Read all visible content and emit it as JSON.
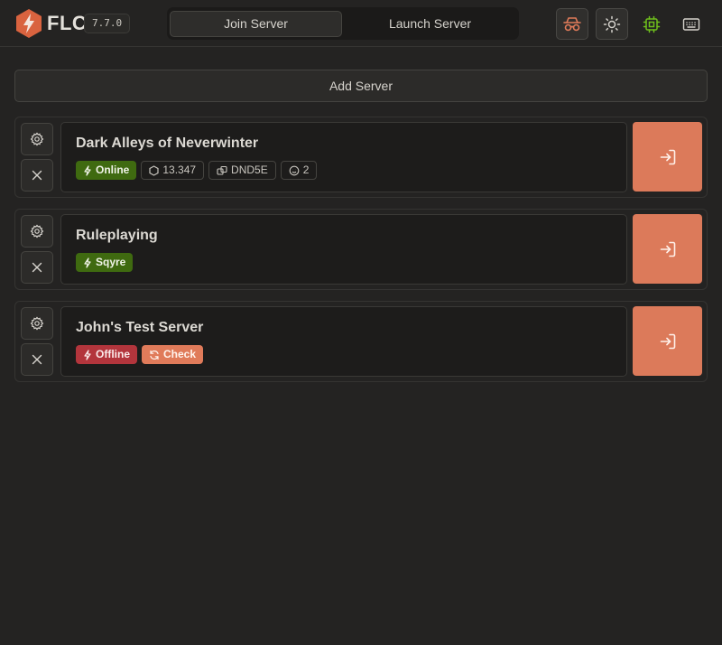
{
  "app": {
    "brand": "FLC",
    "version": "7.7.0"
  },
  "tabs": [
    {
      "label": "Join Server",
      "active": true
    },
    {
      "label": "Launch Server",
      "active": false
    }
  ],
  "header_icons": [
    "incognito-icon",
    "sun-icon",
    "cpu-icon",
    "keyboard-icon"
  ],
  "add_server_label": "Add Server",
  "servers": [
    {
      "name": "Dark Alleys of Neverwinter",
      "status": "Online",
      "version": "13.347",
      "system": "DND5E",
      "players": "2"
    },
    {
      "name": "Ruleplaying",
      "status": "Sqyre"
    },
    {
      "name": "John's Test Server",
      "status": "Offline",
      "action": "Check"
    }
  ],
  "colors": {
    "accent": "#dc7a5a",
    "online": "#3f6a10",
    "offline": "#b3353c",
    "cpu": "#6fbf1c",
    "background": "#242322"
  }
}
